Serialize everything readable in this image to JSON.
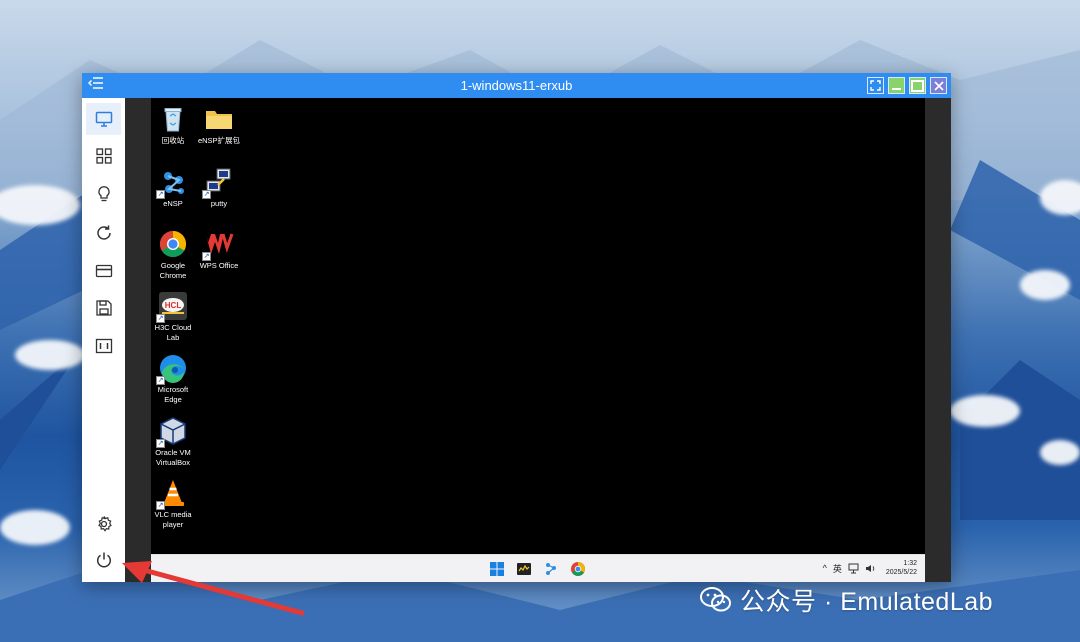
{
  "window": {
    "title": "1-windows11-erxub",
    "menu_icon": "menu-collapse-icon",
    "controls": [
      "fullscreen-icon",
      "minimize-icon",
      "maximize-icon",
      "close-icon"
    ]
  },
  "toolbar": {
    "top_items": [
      {
        "name": "display",
        "icon": "monitor-icon"
      },
      {
        "name": "apps",
        "icon": "grid-icon"
      },
      {
        "name": "tips",
        "icon": "lightbulb-icon"
      },
      {
        "name": "refresh",
        "icon": "refresh-icon"
      },
      {
        "name": "card",
        "icon": "card-icon"
      },
      {
        "name": "save",
        "icon": "save-icon"
      },
      {
        "name": "ratio",
        "icon": "ratio-1-1-icon"
      }
    ],
    "bottom_items": [
      {
        "name": "settings",
        "icon": "gear-icon"
      },
      {
        "name": "power",
        "icon": "power-icon"
      }
    ]
  },
  "desktop": {
    "icons": [
      {
        "label": "回收站"
      },
      {
        "label": "eNSP扩展包"
      },
      {
        "label": "eNSP"
      },
      {
        "label": "putty"
      },
      {
        "label": "Google Chrome"
      },
      {
        "label": "WPS Office"
      },
      {
        "label": "H3C Cloud Lab"
      },
      {
        "label": "Microsoft Edge"
      },
      {
        "label": "Oracle VM VirtualBox"
      },
      {
        "label": "VLC media player"
      }
    ]
  },
  "taskbar": {
    "apps": [
      "windows-start-icon",
      "terminal-app-icon",
      "ensp-app-icon",
      "chrome-icon"
    ],
    "tray": {
      "chevron": "^",
      "ime": "英",
      "time": "1:32",
      "date": "2025/5/22"
    }
  },
  "watermark": {
    "text": "公众号 · EmulatedLab"
  },
  "colors": {
    "titlebar": "#2f8df2",
    "arrow": "#e53935",
    "desktop": "#000000"
  }
}
